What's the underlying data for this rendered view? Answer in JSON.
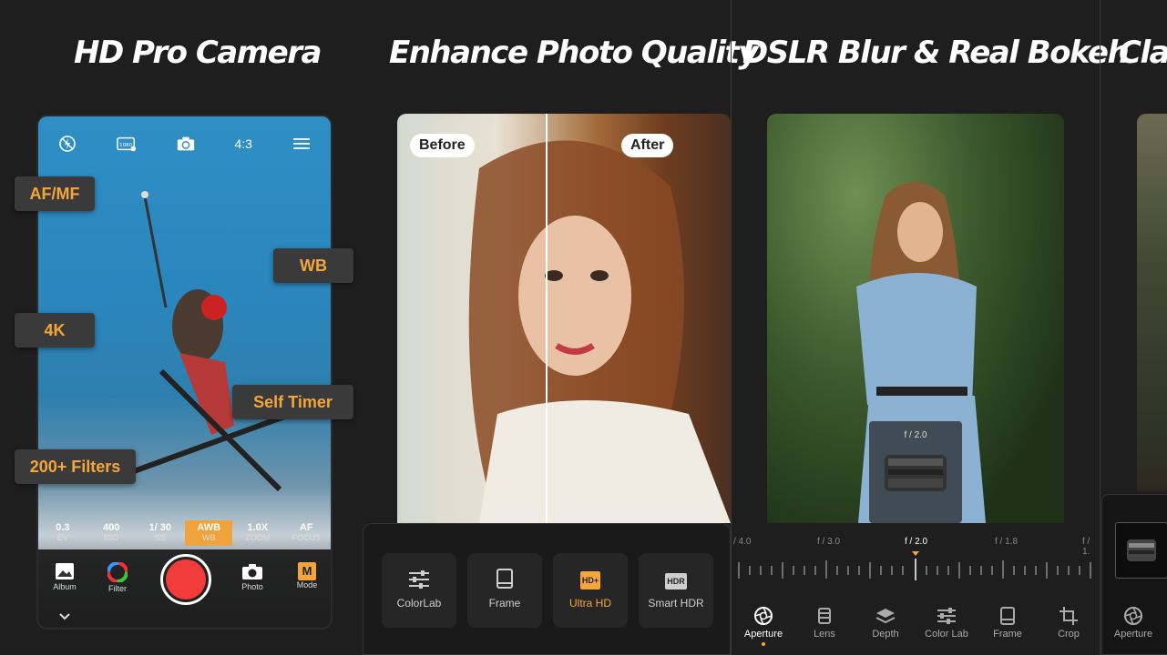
{
  "titles": {
    "panel1": "HD Pro Camera",
    "panel2": "Enhance Photo Quality",
    "panel3": "DSLR Blur & Real Bokeh",
    "panel4": "Clas"
  },
  "camera": {
    "top_icons": [
      "flash-off-icon",
      "resolution-1080-icon",
      "switch-camera-icon"
    ],
    "aspect_ratio": "4:3",
    "params": [
      {
        "value": "0.3",
        "label": "EV"
      },
      {
        "value": "400",
        "label": "ISO"
      },
      {
        "value": "1/ 30",
        "label": "SS"
      },
      {
        "value": "AWB",
        "label": "WB"
      },
      {
        "value": "1.0X",
        "label": "ZOOM"
      },
      {
        "value": "AF",
        "label": "FOCUS"
      }
    ],
    "bottom": {
      "album": "Album",
      "filter": "Filter",
      "photo": "Photo",
      "mode": "Mode",
      "mode_badge": "M"
    }
  },
  "badges": {
    "afmf": "AF/MF",
    "wb": "WB",
    "k4": "4K",
    "self_timer": "Self Timer",
    "filters": "200+ Filters"
  },
  "enhance": {
    "before": "Before",
    "after": "After",
    "tools": [
      {
        "label": "ColorLab"
      },
      {
        "label": "Frame"
      },
      {
        "label": "Ultra HD",
        "badge": "HD+"
      },
      {
        "label": "Smart HDR",
        "badge": "HDR"
      }
    ]
  },
  "bokeh": {
    "aperture_value": "f / 2.0",
    "ruler_labels": [
      "/ 4.0",
      "f / 3.0",
      "f / 2.0",
      "f / 1.8",
      "f / 1."
    ],
    "tabs": [
      "Aperture",
      "Lens",
      "Depth",
      "Color Lab",
      "Frame",
      "Crop"
    ]
  },
  "panel4": {
    "tab": "Aperture"
  },
  "colors": {
    "accent": "#f4a63a",
    "shutter": "#f23b3b",
    "background": "#1e1e1e"
  }
}
